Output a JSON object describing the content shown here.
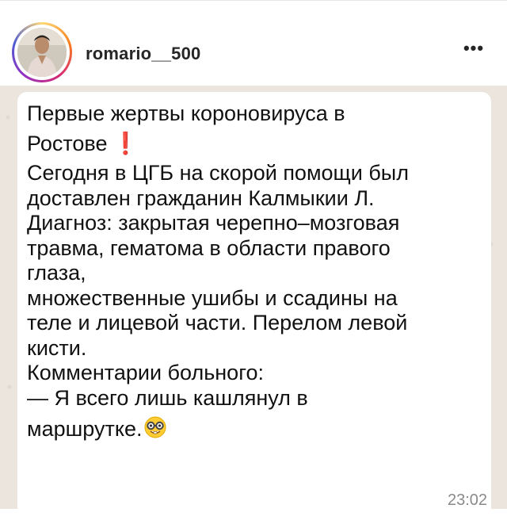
{
  "post": {
    "username": "romario__500",
    "more_label": "•••"
  },
  "message": {
    "line1": "Первые жертвы короновируса в",
    "line2": "Ростове",
    "exclaim": "❗",
    "line3": "Сегодня в ЦГБ на скорой помощи был",
    "line4": "доставлен гражданин Калмыкии Л.",
    "line5": "Диагноз: закрытая черепно–мозговая",
    "line6": "травма, гематома в области правого",
    "line7": "глаза,",
    "line8": "множественные ушибы и ссадины на",
    "line9": "теле и лицевой части. Перелом левой",
    "line10": "кисти.",
    "line11": "Комментарии больного:",
    "line12": "— Я всего лишь кашлянул в",
    "line13": "маршрутке.",
    "emoji": "nerd-face-icon",
    "time": "23:02"
  }
}
